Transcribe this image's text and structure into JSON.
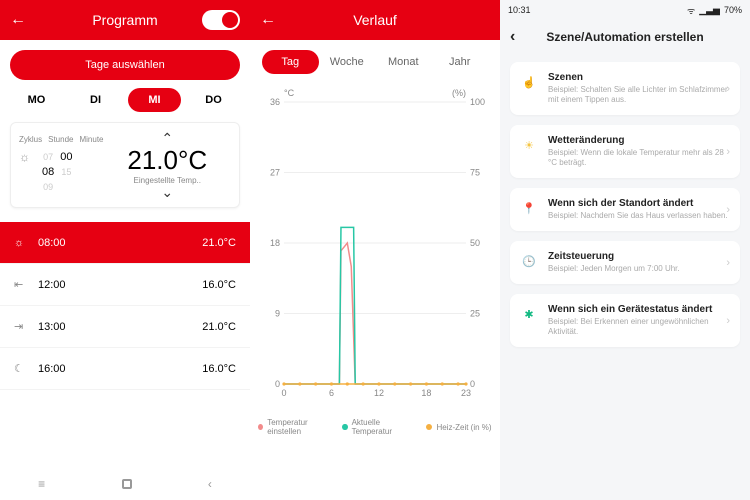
{
  "pane1": {
    "title": "Programm",
    "toggle_on": true,
    "select_days_label": "Tage auswählen",
    "days": [
      "MO",
      "DI",
      "MI",
      "DO"
    ],
    "active_day_index": 2,
    "card": {
      "col_labels": [
        "Zyklus",
        "Stunde",
        "Minute"
      ],
      "hour_prev": "07",
      "hour": "08",
      "hour_next": "09",
      "minute_prev": "",
      "minute": "00",
      "minute_next": "15",
      "temp": "21.0°C",
      "sub": "Eingestellte Temp.."
    },
    "rows": [
      {
        "icon": "bulb-icon",
        "time": "08:00",
        "temp": "21.0°C",
        "active": true
      },
      {
        "icon": "leave-icon",
        "time": "12:00",
        "temp": "16.0°C",
        "active": false
      },
      {
        "icon": "return-icon",
        "time": "13:00",
        "temp": "21.0°C",
        "active": false
      },
      {
        "icon": "moon-icon",
        "time": "16:00",
        "temp": "16.0°C",
        "active": false
      }
    ]
  },
  "pane2": {
    "title": "Verlauf",
    "tabs": [
      "Tag",
      "Woche",
      "Monat",
      "Jahr"
    ],
    "active_tab_index": 0,
    "y_left_unit": "°C",
    "y_right_unit": "(%)",
    "legend": [
      {
        "color": "#f28b8b",
        "label": "Temperatur einstellen"
      },
      {
        "color": "#27c7a5",
        "label": "Aktuelle Temperatur"
      },
      {
        "color": "#f5b042",
        "label": "Heiz-Zeit (in %)"
      }
    ]
  },
  "chart_data": {
    "type": "line",
    "x": [
      0,
      6,
      12,
      18,
      23
    ],
    "y_left_ticks": [
      0,
      9,
      18,
      27,
      36
    ],
    "y_right_ticks": [
      0,
      25,
      50,
      75,
      100
    ],
    "xlabel": "",
    "ylabel_left": "°C",
    "ylabel_right": "%",
    "xlim": [
      0,
      23
    ],
    "ylim_left": [
      0,
      36
    ],
    "series": [
      {
        "name": "Temperatur einstellen",
        "axis": "left",
        "color": "#f28b8b",
        "points": [
          [
            0,
            0
          ],
          [
            1,
            0
          ],
          [
            2,
            0
          ],
          [
            3,
            0
          ],
          [
            4,
            0
          ],
          [
            5,
            0
          ],
          [
            6,
            0
          ],
          [
            7,
            0
          ],
          [
            7.2,
            17
          ],
          [
            8,
            18
          ],
          [
            8.5,
            15
          ],
          [
            9,
            0
          ],
          [
            10,
            0
          ],
          [
            12,
            0
          ],
          [
            14,
            0
          ],
          [
            16,
            0
          ],
          [
            18,
            0
          ],
          [
            20,
            0
          ],
          [
            22,
            0
          ],
          [
            23,
            0
          ]
        ]
      },
      {
        "name": "Aktuelle Temperatur",
        "axis": "left",
        "color": "#27c7a5",
        "points": [
          [
            0,
            0
          ],
          [
            1,
            0
          ],
          [
            2,
            0
          ],
          [
            3,
            0
          ],
          [
            4,
            0
          ],
          [
            5,
            0
          ],
          [
            6,
            0
          ],
          [
            7,
            0
          ],
          [
            7.2,
            20
          ],
          [
            8,
            20
          ],
          [
            8.8,
            20
          ],
          [
            9,
            0
          ],
          [
            10,
            0
          ],
          [
            12,
            0
          ],
          [
            14,
            0
          ],
          [
            16,
            0
          ],
          [
            18,
            0
          ],
          [
            20,
            0
          ],
          [
            22,
            0
          ],
          [
            23,
            0
          ]
        ]
      },
      {
        "name": "Heiz-Zeit (in %)",
        "axis": "right",
        "color": "#f5b042",
        "points": [
          [
            0,
            0
          ],
          [
            2,
            0
          ],
          [
            4,
            0
          ],
          [
            6,
            0
          ],
          [
            8,
            0
          ],
          [
            10,
            0
          ],
          [
            12,
            0
          ],
          [
            14,
            0
          ],
          [
            16,
            0
          ],
          [
            18,
            0
          ],
          [
            20,
            0
          ],
          [
            22,
            0
          ],
          [
            23,
            0
          ]
        ]
      }
    ]
  },
  "pane3": {
    "status": {
      "time": "10:31",
      "battery": "70%"
    },
    "title": "Szene/Automation erstellen",
    "items": [
      {
        "icon": "hand-icon",
        "color": "#f58f45",
        "title": "Szenen",
        "sub": "Beispiel: Schalten Sie alle Lichter im Schlafzimmer mit einem Tippen aus."
      },
      {
        "icon": "sun-icon",
        "color": "#f5c542",
        "title": "Wetteränderung",
        "sub": "Beispiel: Wenn die lokale Temperatur mehr als 28 °C beträgt."
      },
      {
        "icon": "pin-icon",
        "color": "#e63946",
        "title": "Wenn sich der Standort ändert",
        "sub": "Beispiel: Nachdem Sie das Haus verlassen haben."
      },
      {
        "icon": "clock-icon",
        "color": "#3b82f6",
        "title": "Zeitsteuerung",
        "sub": "Beispiel: Jeden Morgen um 7:00 Uhr."
      },
      {
        "icon": "device-icon",
        "color": "#10b981",
        "title": "Wenn sich ein Gerätestatus ändert",
        "sub": "Beispiel: Bei Erkennen einer ungewöhnlichen Aktivität."
      }
    ]
  }
}
